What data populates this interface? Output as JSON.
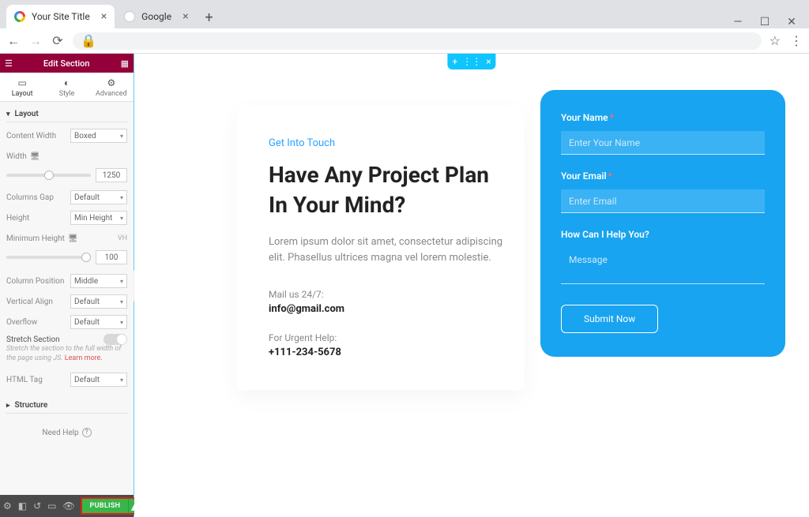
{
  "browser": {
    "tabs": [
      {
        "title": "Your Site Title",
        "active": true
      },
      {
        "title": "Google",
        "active": false
      }
    ]
  },
  "sidebar": {
    "header_title": "Edit Section",
    "tabs": {
      "layout": "Layout",
      "style": "Style",
      "advanced": "Advanced"
    },
    "sections": {
      "layout_title": "Layout",
      "structure_title": "Structure"
    },
    "controls": {
      "content_width": {
        "label": "Content Width",
        "value": "Boxed"
      },
      "width": {
        "label": "Width",
        "value": "1250"
      },
      "columns_gap": {
        "label": "Columns Gap",
        "value": "Default"
      },
      "height": {
        "label": "Height",
        "value": "Min Height"
      },
      "min_height": {
        "label": "Minimum Height",
        "unit_hint": "VH",
        "value": "100"
      },
      "column_position": {
        "label": "Column Position",
        "value": "Middle"
      },
      "vertical_align": {
        "label": "Vertical Align",
        "value": "Default"
      },
      "overflow": {
        "label": "Overflow",
        "value": "Default"
      },
      "stretch": {
        "label": "Stretch Section",
        "note": "Stretch the section to the full width of the page using JS.",
        "learn": "Learn more."
      },
      "html_tag": {
        "label": "HTML Tag",
        "value": "Default"
      }
    },
    "need_help": "Need Help",
    "footer": {
      "publish": "PUBLISH"
    }
  },
  "canvas": {
    "left": {
      "subtitle": "Get Into Touch",
      "heading_line1": "Have Any Project Plan",
      "heading_line2": "In Your Mind?",
      "body": "Lorem ipsum dolor sit amet, consectetur adipiscing elit. Phasellus ultrices magna vel lorem molestie.",
      "mail_label": "Mail us 24/7:",
      "mail_value": "info@gmail.com",
      "phone_label": "For Urgent Help:",
      "phone_value": "+111-234-5678"
    },
    "form": {
      "name_label": "Your Name",
      "name_placeholder": "Enter Your Name",
      "email_label": "Your Email",
      "email_placeholder": "Enter Email",
      "help_label": "How Can I Help You?",
      "message_placeholder": "Message",
      "submit": "Submit Now"
    }
  }
}
